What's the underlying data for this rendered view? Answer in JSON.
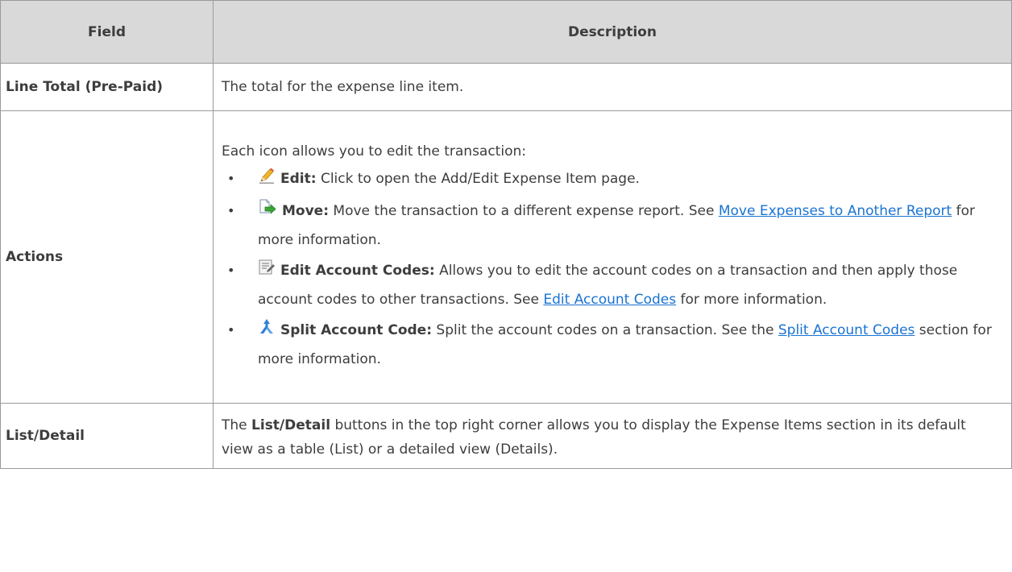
{
  "table": {
    "headers": {
      "field": "Field",
      "description": "Description"
    },
    "rows": [
      {
        "field": "Line Total (Pre-Paid)",
        "description": "The total for the expense line item."
      },
      {
        "field": "Actions",
        "intro": "Each icon allows you to edit the transaction:",
        "items": [
          {
            "icon": "pencil-icon",
            "label": "Edit:",
            "text": " Click to open the Add/Edit Expense Item page."
          },
          {
            "icon": "move-document-icon",
            "label": "Move:",
            "text": " Move the transaction to a different expense report. See ",
            "link": "Move Expenses to Another Report",
            "after": " for more information."
          },
          {
            "icon": "edit-codes-icon",
            "label": "Edit Account Codes:",
            "text": " Allows you to edit the account codes on a transaction and then apply those account codes to other transactions. See ",
            "link": "Edit Account Codes",
            "after": " for more information."
          },
          {
            "icon": "split-icon",
            "label": "Split Account Code:",
            "text": " Split the account codes on a transaction. See the ",
            "link": "Split Account Codes",
            "after": " section for more information."
          }
        ]
      },
      {
        "field": "List/Detail",
        "before": "The ",
        "bold": "List/Detail",
        "after": " buttons in the top right corner allows you to display the Expense Items section in its default view as a table (List) or a detailed view (Details)."
      }
    ]
  },
  "colors": {
    "header_bg": "#d9d9d9",
    "border": "#9a9a9a",
    "text": "#3d3d3d",
    "link": "#1a73d2"
  }
}
